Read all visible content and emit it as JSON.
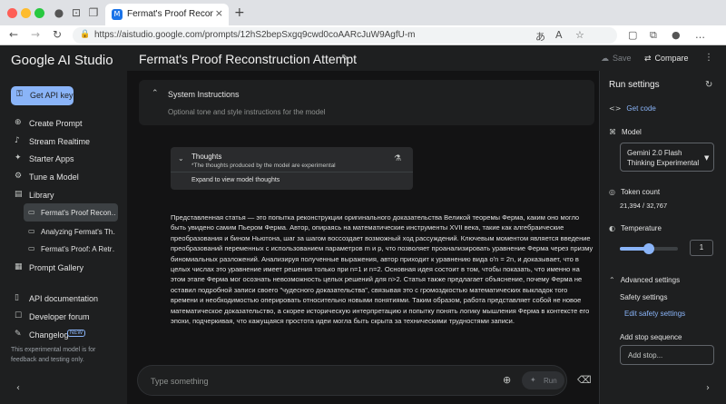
{
  "browser": {
    "tab_title": "Fermat's Proof Reconstruction",
    "tab_favicon": "M",
    "url": "https://aistudio.google.com/prompts/12hS2bepSxgq9cwd0coAARcJuW9AgfU-m",
    "icons": {
      "back": "←",
      "forward": "→",
      "reload": "↻",
      "lock": "🔒",
      "translate": "あ",
      "reader": "A",
      "favorite": "☆",
      "split": "▢",
      "collections": "⧉",
      "profile": "●",
      "more": "…",
      "sidebar_toggle": "▭",
      "workspaces": "⊡",
      "tab_actions": "❐",
      "close_tab": "×",
      "new_tab": "+"
    }
  },
  "brand": "Google AI Studio",
  "sidebar": {
    "api_key_button": "Get API key",
    "nav": [
      {
        "label": "Create Prompt",
        "icon": "⊕"
      },
      {
        "label": "Stream Realtime",
        "icon": "♪"
      },
      {
        "label": "Starter Apps",
        "icon": "✦"
      },
      {
        "label": "Tune a Model",
        "icon": "⚙"
      },
      {
        "label": "Library",
        "icon": "▤"
      }
    ],
    "library_items": [
      {
        "label": "Fermat's Proof Recon…",
        "icon": "▭"
      },
      {
        "label": "Analyzing Fermat's Th…",
        "icon": "▭"
      },
      {
        "label": "Fermat's Proof: A Retr…",
        "icon": "▭"
      }
    ],
    "prompt_gallery": {
      "label": "Prompt Gallery",
      "icon": "▦"
    },
    "bottom_nav": [
      {
        "label": "API documentation",
        "icon": "▯"
      },
      {
        "label": "Developer forum",
        "icon": "☐"
      },
      {
        "label": "Changelog",
        "icon": "✎",
        "badge": "NEW"
      }
    ],
    "note": "This experimental model is for feedback and testing only.",
    "collapse_icon": "‹"
  },
  "header": {
    "title": "Fermat's Proof Reconstruction Attempt",
    "edit_icon": "✎",
    "save_label": "Save",
    "save_icon": "☁",
    "compare_label": "Compare",
    "compare_icon": "⇄",
    "more_icon": "⋮"
  },
  "system_instructions": {
    "title": "System Instructions",
    "placeholder": "Optional tone and style instructions for the model",
    "chevron": "⌃"
  },
  "thoughts": {
    "title": "Thoughts",
    "subtitle": "*The thoughts produced by the model are experimental",
    "expand_label": "Expand to view model thoughts",
    "chevron": "⌄",
    "flask_icon": "⚗"
  },
  "response_text": "Представленная статья — это попытка реконструкции оригинального доказательства Великой теоремы Ферма, каким оно могло быть увидено самим Пьером Ферма. Автор, опираясь на математические инструменты XVII века, такие как алгебраические преобразования и бином Ньютона, шаг за шагом воссоздает возможный ход рассуждений. Ключевым моментом является введение преобразований переменных с использованием параметров m и p, что позволяет проанализировать уравнение Ферма через призму биномиальных разложений. Анализируя полученные выражения, автор приходит к уравнению вида oʹn = 2n, и доказывает, что в целых числах это уравнение имеет решения только при n=1 и n=2. Основная идея состоит в том, чтобы показать, что именно на этом этапе Ферма мог осознать невозможность целых решений для n>2. Статья также предлагает объяснение, почему Ферма не оставил подробной записи своего \"чудесного доказательства\", связывая это с громоздкостью математических выкладок того времени и необходимостью оперировать относительно новыми понятиями. Таким образом, работа представляет собой не новое математическое доказательство, а скорее историческую интерпретацию и попытку понять логику мышления Ферма в контексте его эпохи, подчеркивая, что кажущаяся простота идеи могла быть скрыта за техническими трудностями записи.",
  "input": {
    "placeholder": "Type something",
    "add_icon": "⊕",
    "run_label": "Run",
    "run_icon": "✦",
    "clear_icon": "⌫"
  },
  "run_settings": {
    "title": "Run settings",
    "reset_icon": "↻",
    "get_code": {
      "label": "Get code",
      "icon": "<>"
    },
    "model": {
      "label": "Model",
      "icon": "⌘",
      "selected": "Gemini 2.0 Flash Thinking Experimental",
      "caret": "▼"
    },
    "token_count": {
      "label": "Token count",
      "icon": "◎",
      "value": "21,394 / 32,767"
    },
    "temperature": {
      "label": "Temperature",
      "icon": "◐",
      "value": "1",
      "fraction": 0.5
    },
    "advanced": {
      "label": "Advanced settings",
      "icon": "⌃"
    },
    "safety": {
      "label": "Safety settings",
      "link": "Edit safety settings"
    },
    "stop_sequence": {
      "label": "Add stop sequence",
      "placeholder": "Add stop..."
    },
    "expand_icon": "›"
  },
  "colors": {
    "accent": "#8ab4f8",
    "background": "#131314",
    "panel": "#1e1f20"
  }
}
